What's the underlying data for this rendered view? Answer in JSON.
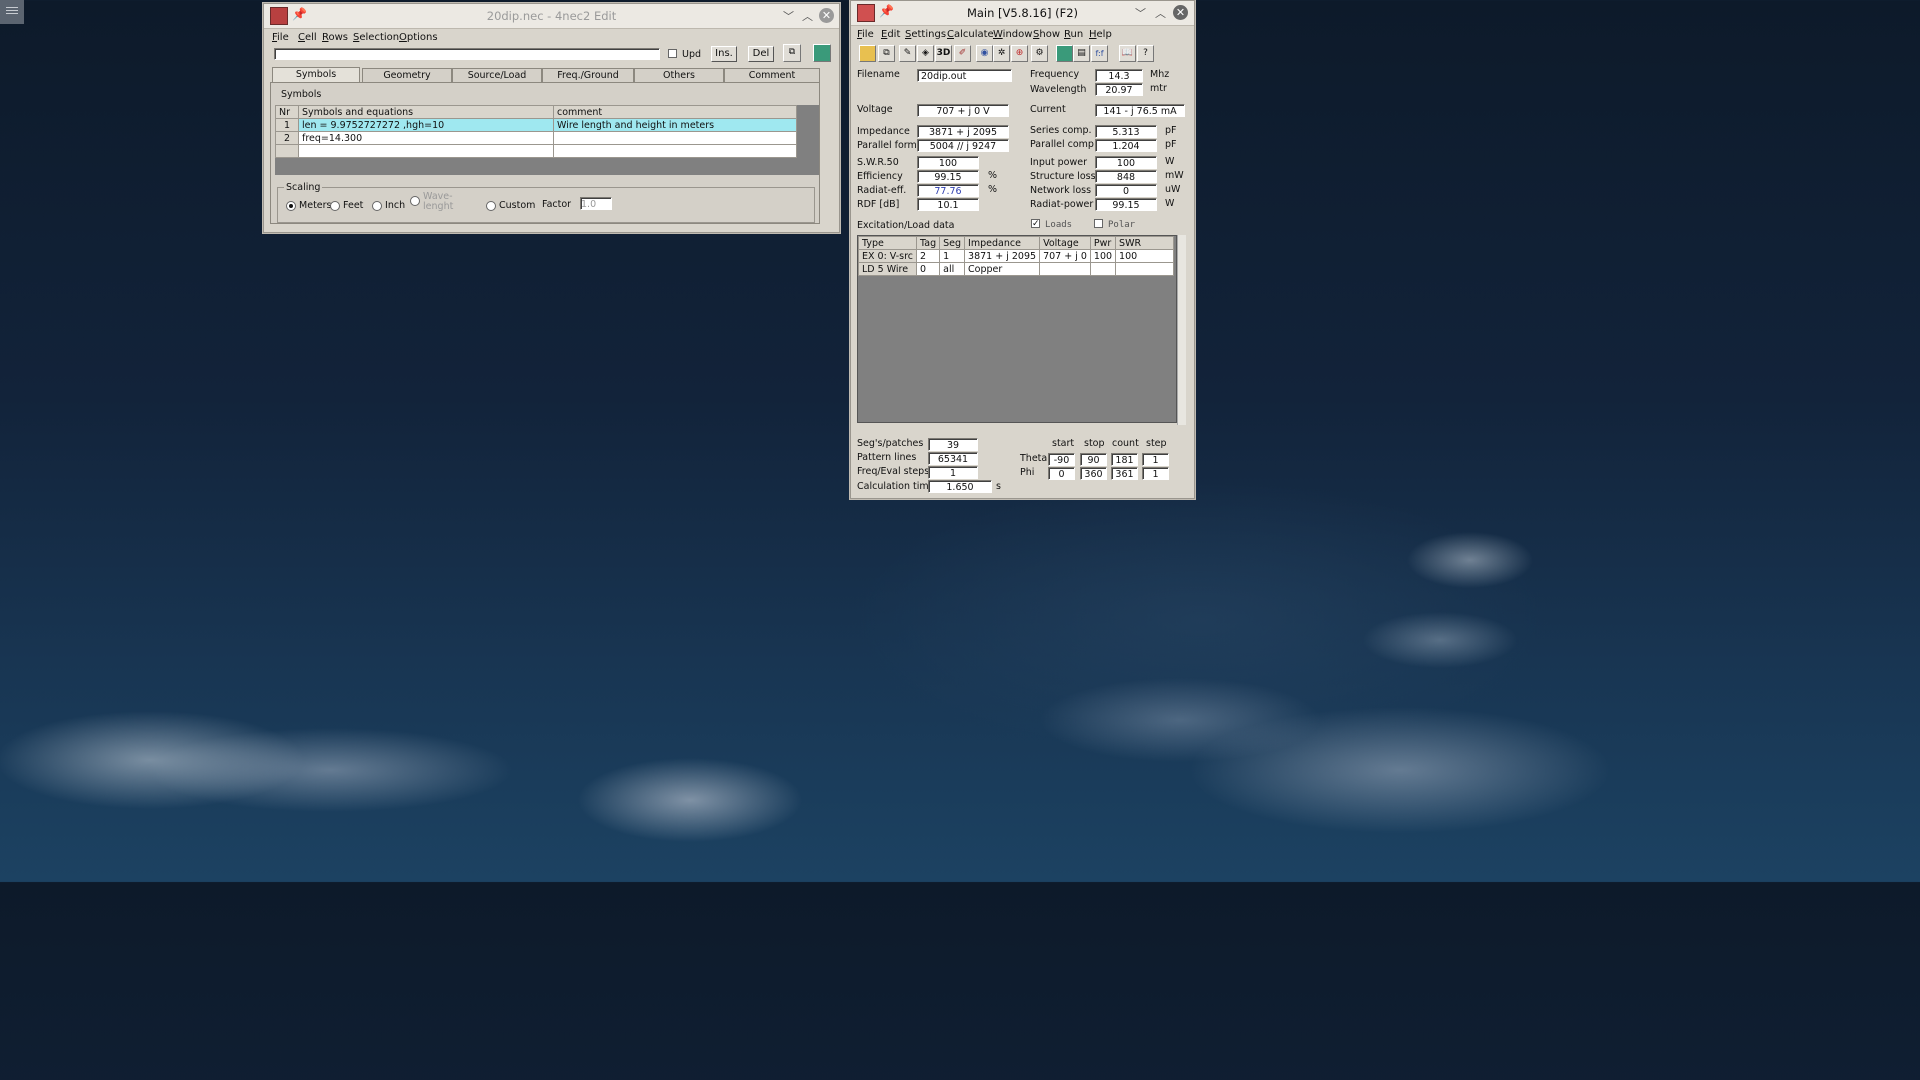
{
  "edit_window": {
    "title": "20dip.nec - 4nec2 Edit",
    "menu": [
      "File",
      "Cell",
      "Rows",
      "Selection",
      "Options"
    ],
    "upd_label": "Upd",
    "ins_label": "Ins.",
    "del_label": "Del",
    "tabs": [
      "Symbols",
      "Geometry",
      "Source/Load",
      "Freq./Ground",
      "Others",
      "Comment"
    ],
    "section_label": "Symbols",
    "table": {
      "headers": [
        "Nr",
        "Symbols and equations",
        "comment"
      ],
      "rows": [
        {
          "nr": "1",
          "expr": "len = 9.9752727272 ,hgh=10",
          "comment": "Wire length and height in meters"
        },
        {
          "nr": "2",
          "expr": "freq=14.300",
          "comment": ""
        }
      ]
    },
    "scaling": {
      "label": "Scaling",
      "options": [
        "Meters",
        "Feet",
        "Inch",
        "Wave-\nlenght",
        "Custom"
      ],
      "selected": "Meters",
      "factor_label": "Factor",
      "factor_value": "1.0"
    }
  },
  "main_window": {
    "title": "Main [V5.8.16]  (F2)",
    "menu": [
      "File",
      "Edit",
      "Settings",
      "Calculate",
      "Window",
      "Show",
      "Run",
      "Help"
    ],
    "fields": {
      "filename_label": "Filename",
      "filename": "20dip.out",
      "frequency_label": "Frequency",
      "frequency": "14.3",
      "frequency_unit": "Mhz",
      "wavelength_label": "Wavelength",
      "wavelength": "20.97",
      "wavelength_unit": "mtr",
      "voltage_label": "Voltage",
      "voltage": "707 + j 0 V",
      "current_label": "Current",
      "current": "141 - j 76.5 mA",
      "impedance_label": "Impedance",
      "impedance": "3871 + j 2095",
      "series_label": "Series comp.",
      "series": "5.313",
      "series_unit": "pF",
      "parallel_label": "Parallel form",
      "parallel": "5004 // j 9247",
      "parcomp_label": "Parallel comp.",
      "parcomp": "1.204",
      "parcomp_unit": "pF",
      "swr_label": "S.W.R.50",
      "swr": "100",
      "inpower_label": "Input power",
      "inpower": "100",
      "inpower_unit": "W",
      "eff_label": "Efficiency",
      "eff": "99.15",
      "eff_unit": "%",
      "structloss_label": "Structure loss",
      "structloss": "848",
      "structloss_unit": "mW",
      "radeff_label": "Radiat-eff.",
      "radeff": "77.76",
      "radeff_unit": "%",
      "netloss_label": "Network loss",
      "netloss": "0",
      "netloss_unit": "uW",
      "rdf_label": "RDF [dB]",
      "rdf": "10.1",
      "radpower_label": "Radiat-power",
      "radpower": "99.15",
      "radpower_unit": "W"
    },
    "excitation_label": "Excitation/Load data",
    "loads_label": "Loads",
    "polar_label": "Polar",
    "exc_table": {
      "headers": [
        "Type",
        "Tag",
        "Seg",
        "Impedance",
        "Voltage",
        "Pwr",
        "SWR"
      ],
      "rows": [
        [
          "EX 0: V-src",
          "2",
          "1",
          "3871 + j 2095",
          "707 + j 0",
          "100",
          "100"
        ],
        [
          "LD 5 Wire",
          "0",
          "all",
          "Copper",
          "",
          "",
          ""
        ]
      ]
    },
    "bottom": {
      "segs_label": "Seg's/patches",
      "segs": "39",
      "pattern_label": "Pattern lines",
      "pattern": "65341",
      "freqsteps_label": "Freq/Eval steps",
      "freqsteps": "1",
      "calctime_label": "Calculation time",
      "calctime": "1.650",
      "calctime_unit": "s",
      "col_start": "start",
      "col_stop": "stop",
      "col_count": "count",
      "col_step": "step",
      "theta_label": "Theta",
      "theta": [
        "-90",
        "90",
        "181",
        "1"
      ],
      "phi_label": "Phi",
      "phi": [
        "0",
        "360",
        "361",
        "1"
      ]
    }
  }
}
